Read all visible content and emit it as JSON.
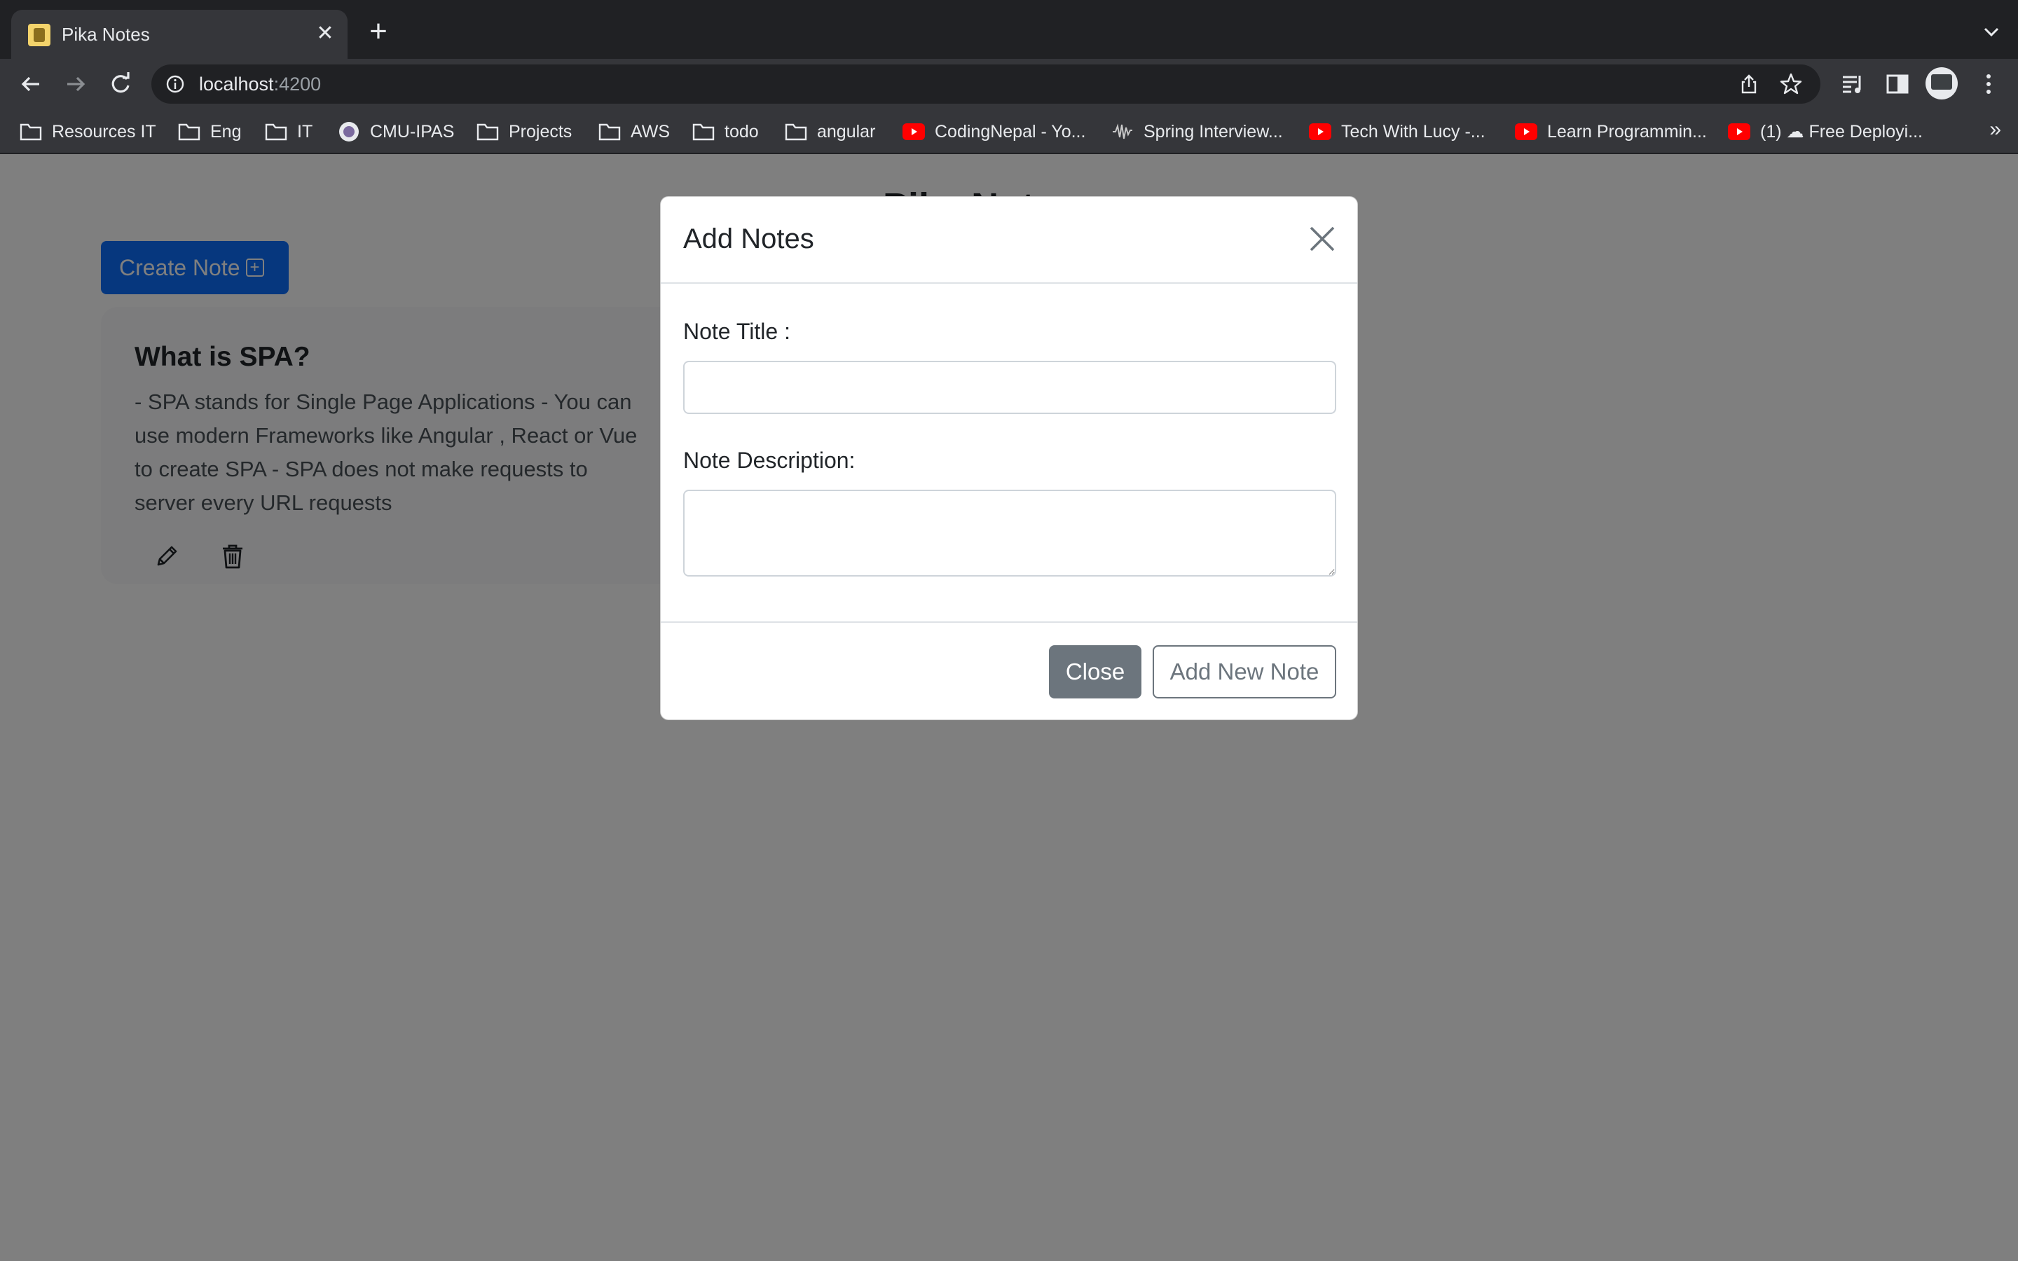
{
  "browser": {
    "tab_title": "Pika Notes",
    "url_host": "localhost",
    "url_port": ":4200",
    "bookmarks": [
      {
        "label": "Resources IT",
        "icon": "folder-icon"
      },
      {
        "label": "Eng",
        "icon": "folder-icon"
      },
      {
        "label": "IT",
        "icon": "folder-icon"
      },
      {
        "label": "CMU-IPAS",
        "icon": "site-icon"
      },
      {
        "label": "Projects",
        "icon": "folder-icon"
      },
      {
        "label": "AWS",
        "icon": "folder-icon"
      },
      {
        "label": "todo",
        "icon": "folder-icon"
      },
      {
        "label": "angular",
        "icon": "folder-icon"
      },
      {
        "label": "CodingNepal - Yo...",
        "icon": "youtube-icon"
      },
      {
        "label": "Spring Interview...",
        "icon": "waveform-icon"
      },
      {
        "label": "Tech With Lucy -...",
        "icon": "youtube-icon"
      },
      {
        "label": "Learn Programmin...",
        "icon": "youtube-icon"
      },
      {
        "label": "(1) ☁ Free Deployi...",
        "icon": "youtube-icon"
      }
    ],
    "bookmarks_overflow": "»"
  },
  "page": {
    "title": "Pika Notes",
    "create_button": "Create Note",
    "notes": [
      {
        "title": "What is SPA?",
        "description": "- SPA stands for Single Page Applications - You can use modern Frameworks like Angular , React or Vue to create SPA - SPA does not make requests to server every URL requests"
      }
    ]
  },
  "modal": {
    "title": "Add Notes",
    "title_label": "Note Title :",
    "title_value": "",
    "description_label": "Note Description:",
    "description_value": "",
    "close_button": "Close",
    "add_button": "Add New Note"
  },
  "colors": {
    "primary": "#0d6efd",
    "secondary": "#6c757d",
    "chrome_dark": "#202124",
    "chrome_toolbar": "#35363a"
  }
}
